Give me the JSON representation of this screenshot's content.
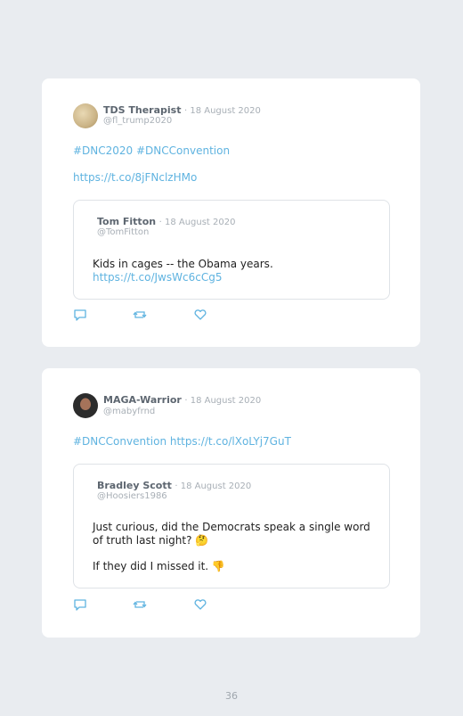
{
  "tweets": [
    {
      "author": "TDS Therapist",
      "date": "· 18 August 2020",
      "handle": "@fl_trump2020",
      "line1": "#DNC2020 #DNCConvention",
      "line2": "https://t.co/8jFNclzHMo",
      "quote": {
        "author": "Tom Fitton",
        "date": "· 18 August 2020",
        "handle": "@TomFitton",
        "text": "Kids in cages -- the Obama years.",
        "link": "https://t.co/JwsWc6cCg5"
      }
    },
    {
      "author": "MAGA-Warrior",
      "date": "· 18 August 2020",
      "handle": "@mabyfrnd",
      "line1": "#DNCConvention https://t.co/lXoLYj7GuT",
      "quote": {
        "author": "Bradley Scott",
        "date": "· 18 August 2020",
        "handle": "@Hoosiers1986",
        "text1": "Just curious, did the Democrats speak a single word of truth last night? 🤔",
        "text2": "If they did I missed it. 👎"
      }
    }
  ],
  "page_number": "36",
  "icons": [
    "reply-icon",
    "retweet-icon",
    "like-icon"
  ],
  "colors": {
    "link": "#5fb3e0",
    "background": "#e9ecf0",
    "card": "#ffffff"
  }
}
